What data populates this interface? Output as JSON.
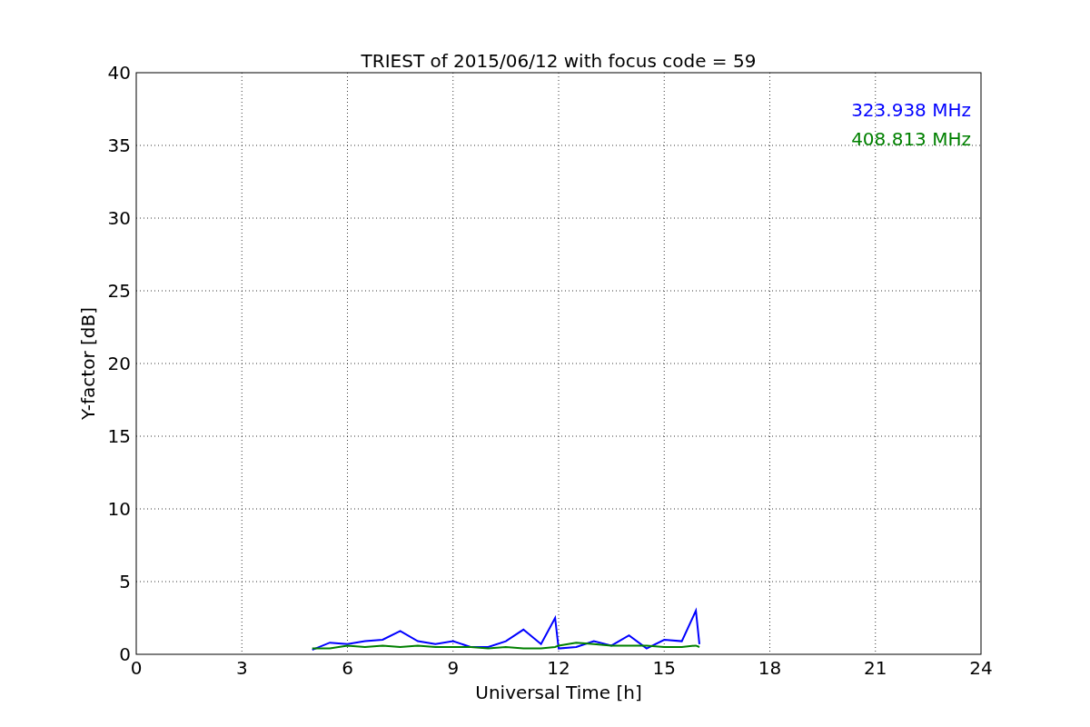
{
  "chart_data": {
    "type": "line",
    "title": "TRIEST of 2015/06/12 with focus code = 59",
    "xlabel": "Universal Time [h]",
    "ylabel": "Y-factor [dB]",
    "x": [
      5,
      5.5,
      6,
      6.5,
      7,
      7.5,
      8,
      8.5,
      9,
      9.5,
      10,
      10.5,
      11,
      11.5,
      11.9,
      12,
      12.5,
      13,
      13.5,
      14,
      14.5,
      15,
      15.5,
      15.9,
      16
    ],
    "series": [
      {
        "name": "323.938 MHz",
        "color": "#0000ff",
        "values": [
          0.3,
          0.8,
          0.7,
          0.9,
          1.0,
          1.6,
          0.9,
          0.7,
          0.9,
          0.5,
          0.5,
          0.9,
          1.7,
          0.7,
          2.5,
          0.4,
          0.5,
          0.9,
          0.6,
          1.3,
          0.4,
          1.0,
          0.9,
          3.0,
          0.7
        ]
      },
      {
        "name": "408.813 MHz",
        "color": "#008000",
        "values": [
          0.4,
          0.4,
          0.6,
          0.5,
          0.6,
          0.5,
          0.6,
          0.5,
          0.5,
          0.5,
          0.4,
          0.5,
          0.4,
          0.4,
          0.5,
          0.6,
          0.8,
          0.7,
          0.6,
          0.6,
          0.6,
          0.5,
          0.5,
          0.6,
          0.5
        ]
      }
    ],
    "xlim": [
      0,
      24
    ],
    "ylim": [
      0,
      40
    ],
    "xticks": [
      0,
      3,
      6,
      9,
      12,
      15,
      18,
      21,
      24
    ],
    "yticks": [
      0,
      5,
      10,
      15,
      20,
      25,
      30,
      35,
      40
    ],
    "grid": true
  }
}
